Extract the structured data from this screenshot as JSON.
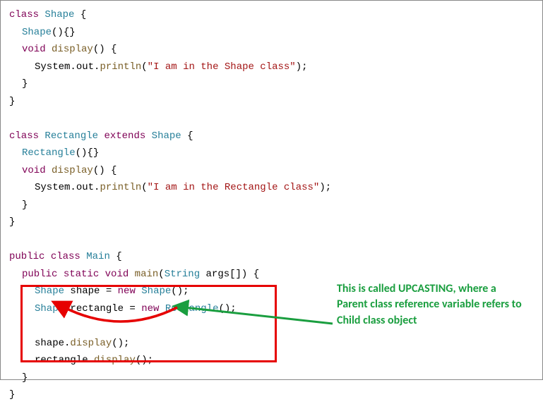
{
  "code": {
    "l1_kw1": "class",
    "l1_cls": "Shape",
    "l1_txt1": " {",
    "l2_cls": "Shape",
    "l2_txt": "(){}",
    "l3_kw": "void",
    "l3_mtd": "display",
    "l3_txt": "() {",
    "l4_obj": "System",
    "l4_dot1": ".",
    "l4_out": "out",
    "l4_dot2": ".",
    "l4_fn": "println",
    "l4_p1": "(",
    "l4_str": "\"I am in the Shape class\"",
    "l4_p2": ");",
    "l5_txt": "}",
    "l6_txt": "}",
    "l7_kw1": "class",
    "l7_cls1": "Rectangle",
    "l7_kw2": "extends",
    "l7_cls2": "Shape",
    "l7_txt": " {",
    "l8_cls": "Rectangle",
    "l8_txt": "(){}",
    "l9_kw": "void",
    "l9_mtd": "display",
    "l9_txt": "() {",
    "l10_obj": "System",
    "l10_dot1": ".",
    "l10_out": "out",
    "l10_dot2": ".",
    "l10_fn": "println",
    "l10_p1": "(",
    "l10_str": "\"I am in the Rectangle class\"",
    "l10_p2": ");",
    "l11_txt": "}",
    "l12_txt": "}",
    "l13_kw1": "public",
    "l13_kw2": "class",
    "l13_cls": "Main",
    "l13_txt": " {",
    "l14_kw1": "public",
    "l14_kw2": "static",
    "l14_kw3": "void",
    "l14_mtd": "main",
    "l14_p1": "(",
    "l14_type": "String",
    "l14_args": " args[]) {",
    "l15_type": "Shape",
    "l15_var": " shape = ",
    "l15_kw": "new",
    "l15_cls": " Shape",
    "l15_txt": "();",
    "l16_type": "Shape",
    "l16_var": " rectangle = ",
    "l16_kw": "new",
    "l16_cls": " Rectangle",
    "l16_txt": "();",
    "l17_obj": "shape",
    "l17_dot": ".",
    "l17_mtd": "display",
    "l17_txt": "();",
    "l18_obj": "rectangle",
    "l18_dot": ".",
    "l18_mtd": "display",
    "l18_txt": "();",
    "l19_txt": "}",
    "l20_txt": "}"
  },
  "annotation": "This is called UPCASTING, where a Parent class reference variable refers to Child class object"
}
